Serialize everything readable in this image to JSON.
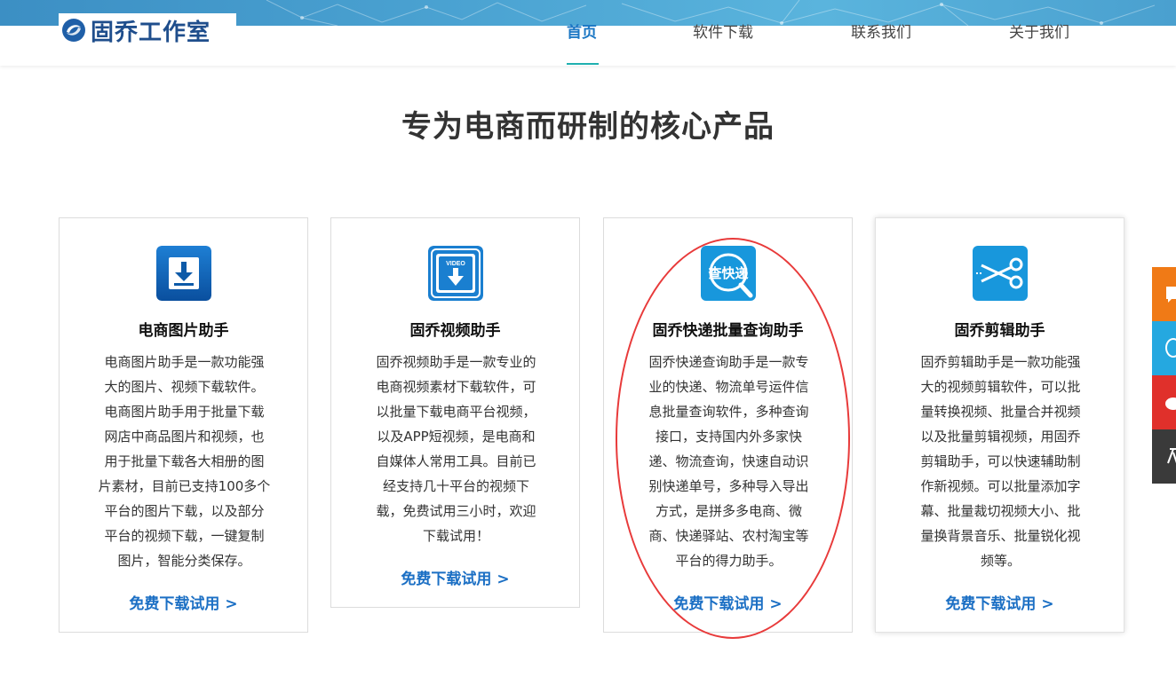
{
  "brand": {
    "name": "固乔工作室",
    "logo_icon": "swirl-logo-icon"
  },
  "nav": {
    "items": [
      {
        "label": "首页",
        "active": true
      },
      {
        "label": "软件下载",
        "active": false
      },
      {
        "label": "联系我们",
        "active": false
      },
      {
        "label": "关于我们",
        "active": false
      }
    ]
  },
  "section": {
    "title": "专为电商而研制的核心产品"
  },
  "products": [
    {
      "icon": "download-arrow-icon",
      "title": "电商图片助手",
      "desc_lines": [
        "电商图片助手是一款功能强",
        "大的图片、视频下载软件。",
        "电商图片助手用于批量下载",
        "网店中商品图片和视频，也",
        "用于批量下载各大相册的图",
        "片素材，目前已支持100多个",
        "平台的图片下载，以及部分",
        "平台的视频下载，一键复制",
        "图片，智能分类保存。"
      ],
      "link": "免费下载试用 >"
    },
    {
      "icon": "video-download-icon",
      "icon_text": "VIDEO",
      "title": "固乔视频助手",
      "desc_lines": [
        "固乔视频助手是一款专业的",
        "电商视频素材下载软件，可",
        "以批量下载电商平台视频，",
        "以及APP短视频，是电商和",
        "自媒体人常用工具。目前已",
        "经支持几十平台的视频下",
        "载，免费试用三小时，欢迎",
        "下载试用！"
      ],
      "link": "免费下载试用 >"
    },
    {
      "icon": "express-search-icon",
      "icon_text": "查快递",
      "title": "固乔快递批量查询助手",
      "desc_lines": [
        "固乔快递查询助手是一款专",
        "业的快递、物流单号运件信",
        "息批量查询软件，多种查询",
        "接口，支持国内外多家快",
        "递、物流查询，快速自动识",
        "别快递单号，多种导入导出",
        "方式，是拼多多电商、微",
        "商、快递驿站、农村淘宝等",
        "平台的得力助手。"
      ],
      "link": "免费下载试用 >"
    },
    {
      "icon": "scissors-icon",
      "title": "固乔剪辑助手",
      "desc_lines": [
        "固乔剪辑助手是一款功能强",
        "大的视频剪辑软件，可以批",
        "量转换视频、批量合并视频",
        "以及批量剪辑视频，用固乔",
        "剪辑助手，可以快速辅助制",
        "作新视频。可以批量添加字",
        "幕、批量裁切视频大小、批",
        "量换背景音乐、批量锐化视",
        "频等。"
      ],
      "link": "免费下载试用 >"
    }
  ],
  "side_bar": {
    "buttons": [
      {
        "icon": "chat-icon",
        "color": "#f07a16"
      },
      {
        "icon": "qq-icon",
        "color": "#25a8e0"
      },
      {
        "icon": "weibo-icon",
        "color": "#e0302b"
      },
      {
        "icon": "back-to-top-icon",
        "color": "#3a3a3a"
      }
    ]
  },
  "colors": {
    "accent": "#1b6fc4",
    "nav_active": "#1b77c4",
    "highlight_ring": "#e83a3a"
  }
}
